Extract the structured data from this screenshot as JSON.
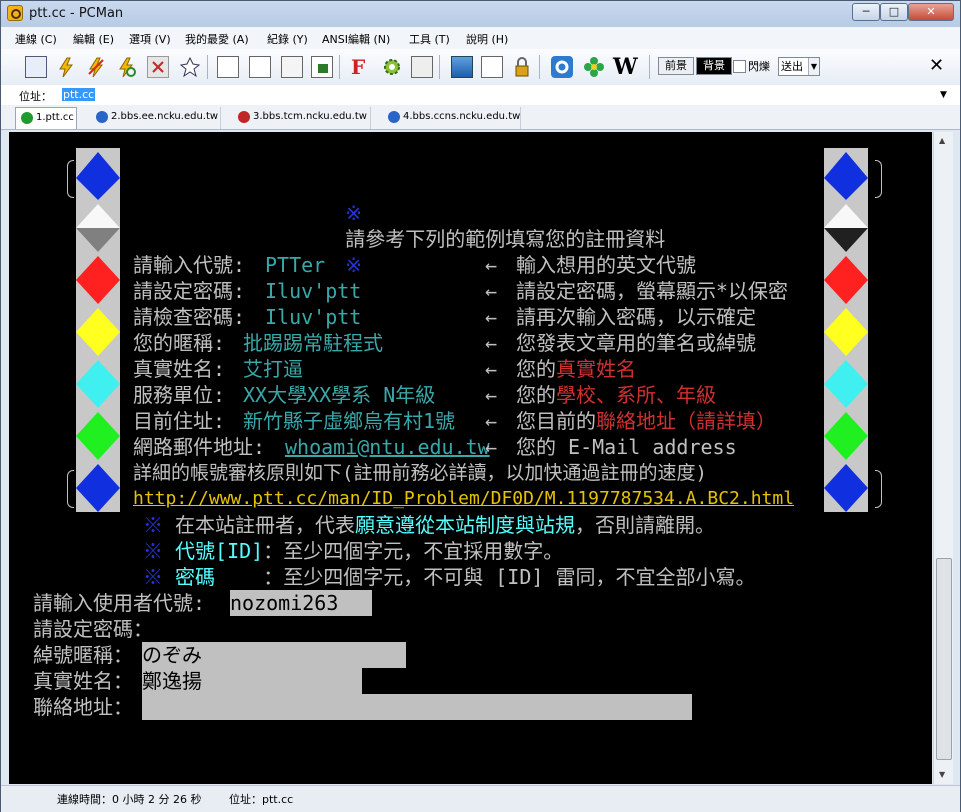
{
  "window": {
    "title": "ptt.cc - PCMan",
    "min": "─",
    "max": "□",
    "close": "✕"
  },
  "menu": [
    "連線 (C)",
    "編輯 (E)",
    "選項 (V)",
    "我的最愛 (A)",
    "紀錄 (Y)",
    "ANSI編輯 (N)",
    "工具 (T)",
    "說明 (H)"
  ],
  "toolbar": {
    "icons": [
      "address-book-icon",
      "connect-icon",
      "disconnect-icon",
      "reconnect-icon",
      "close-tab-icon",
      "pin-icon",
      "copy-icon",
      "paste-icon",
      "copy-article-icon",
      "screenshot-icon",
      "font-icon",
      "settings-icon",
      "fullscreen-icon",
      "picture-icon",
      "ascii-art-icon",
      "lock-icon",
      "google-icon",
      "flower-icon",
      "wikipedia-icon"
    ],
    "font_letter": "F",
    "wiki_letter": "W",
    "fg_label": "前景",
    "bg_label": "背景",
    "blink_label": "閃爍",
    "send_label": "送出",
    "close": "✕"
  },
  "address": {
    "label": "位址：",
    "value": "ptt.cc"
  },
  "tabs": [
    {
      "label": "1.ptt.cc",
      "color": "#1e9a2e"
    },
    {
      "label": "2.bbs.ee.ncku.edu.tw",
      "color": "#2a64c6"
    },
    {
      "label": "3.bbs.tcm.ncku.edu.tw",
      "color": "#c02626"
    },
    {
      "label": "4.bbs.ccns.ncku.edu.tw",
      "color": "#2a64c6"
    }
  ],
  "terminal": {
    "heading_star": "※",
    "heading": "請參考下列的範例填寫您的註冊資料",
    "arrow": "←",
    "rows": [
      {
        "label": "請輸入代號:",
        "example": "PTTer",
        "pre": "輸入想用的英文代號",
        "hi": "",
        "post": ""
      },
      {
        "label": "請設定密碼:",
        "example": "Iluv'ptt",
        "pre": "請設定密碼，螢幕顯示*以保密",
        "hi": "",
        "post": ""
      },
      {
        "label": "請檢查密碼:",
        "example": "Iluv'ptt",
        "pre": "請再次輸入密碼，以示確定",
        "hi": "",
        "post": ""
      },
      {
        "label": "您的暱稱:",
        "example": "批踢踢常駐程式",
        "pre": "您發表文章用的筆名或綽號",
        "hi": "",
        "post": ""
      },
      {
        "label": "真實姓名:",
        "example": "艾打逼",
        "pre": "您的",
        "hi": "真實姓名",
        "post": ""
      },
      {
        "label": "服務單位:",
        "example": "XX大學XX學系 N年級",
        "pre": "您的",
        "hi": "學校、系所、年級",
        "post": ""
      },
      {
        "label": "目前住址:",
        "example": "新竹縣子虛鄉烏有村1號",
        "pre": "您目前的",
        "hi": "聯絡地址（請詳填）",
        "post": ""
      },
      {
        "label": "網路郵件地址:",
        "example": "whoami@ntu.edu.tw",
        "pre": "您的 E-Mail address",
        "hi": "",
        "post": ""
      }
    ],
    "detail": "詳細的帳號審核原則如下(註冊前務必詳讀，以加快通過註冊的速度)",
    "url": "http://www.ptt.cc/man/ID_Problem/DF0D/M.1197787534.A.BC2.html",
    "note1_pre": "在本站註冊者，代表",
    "note1_hi": "願意遵從本站制度與站規",
    "note1_post": "，否則請離開。",
    "note2_key": "代號[ID]",
    "note2_text": "：至少四個字元，不宜採用數字。",
    "note3_key": "密碼",
    "note3_text": "    ：至少四個字元，不可與 [ID] 雷同，不宜全部小寫。",
    "prompts": {
      "userid_label": "請輸入使用者代號:",
      "userid_value": "nozomi263",
      "password_label": "請設定密碼：",
      "nickname_label": "綽號暱稱：",
      "nickname_value": "のぞみ",
      "realname_label": "真實姓名：",
      "realname_value": "鄭逸揚",
      "address_label": "聯絡地址："
    }
  },
  "status": {
    "connect_time": "連線時間：0 小時 2 分 26 秒",
    "address": "位址：ptt.cc"
  }
}
